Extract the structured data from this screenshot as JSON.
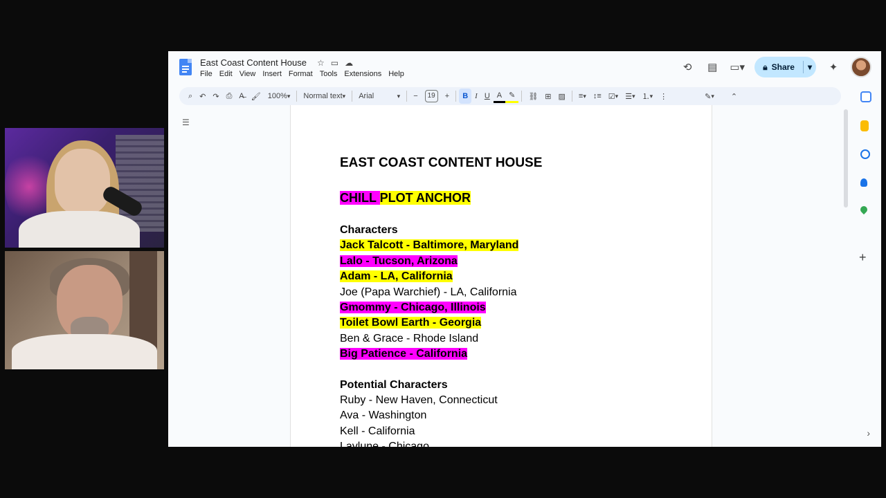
{
  "document": {
    "title": "East Coast Content House",
    "menu": [
      "File",
      "Edit",
      "View",
      "Insert",
      "Format",
      "Tools",
      "Extensions",
      "Help"
    ],
    "share_label": "Share"
  },
  "toolbar": {
    "zoom": "100%",
    "style": "Normal text",
    "font": "Arial",
    "font_size": "19"
  },
  "content": {
    "heading": "EAST COAST CONTENT HOUSE",
    "anchor_part1": "CHILL ",
    "anchor_part2": "PLOT ANCHOR",
    "characters_heading": "Characters",
    "characters": [
      {
        "text": "Jack Talcott - Baltimore, Maryland",
        "bold": true,
        "highlight": "yellow"
      },
      {
        "text": "Lalo - Tucson, Arizona",
        "bold": true,
        "highlight": "magenta"
      },
      {
        "text": "Adam - LA, California",
        "bold": true,
        "highlight": "yellow"
      },
      {
        "text": "Joe (Papa Warchief) - LA, California",
        "bold": false,
        "highlight": "none"
      },
      {
        "text": "Gmommy - Chicago, Illinois",
        "bold": true,
        "highlight": "magenta"
      },
      {
        "text": "Toilet Bowl Earth - Georgia",
        "bold": true,
        "highlight": "yellow"
      },
      {
        "text": "Ben & Grace - Rhode Island",
        "bold": false,
        "highlight": "none"
      },
      {
        "text": "Big Patience - California",
        "bold": true,
        "highlight": "magenta"
      }
    ],
    "potential_heading": "Potential Characters",
    "potential": [
      "Ruby - New Haven, Connecticut",
      "Ava - Washington",
      "Kell - California",
      "Laylune - Chicago"
    ]
  },
  "colors": {
    "highlight_yellow": "#ffff00",
    "highlight_magenta": "#ff00ff",
    "share_bg": "#c2e7ff",
    "docs_blue": "#4285f4"
  }
}
